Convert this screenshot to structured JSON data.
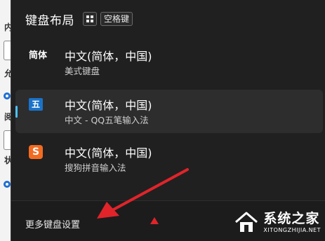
{
  "background_window": {
    "chars": [
      "内",
      "允",
      "阅",
      "状"
    ]
  },
  "flyout": {
    "title": "键盘布局",
    "layout_hotkey": "空格键",
    "items": [
      {
        "icon_text": "简体",
        "name": "中文(简体，中国)",
        "sub": "美式键盘",
        "selected": false
      },
      {
        "icon_text": "五",
        "name": "中文(简体，中国)",
        "sub": "中文 - QQ五笔输入法",
        "selected": true
      },
      {
        "icon_text": "S",
        "name": "中文(简体，中国)",
        "sub": "搜狗拼音输入法",
        "selected": false
      }
    ],
    "more_settings": "更多键盘设置"
  },
  "watermark": {
    "title": "系统之家",
    "url": "XITONGZHIJIA.NET"
  },
  "colors": {
    "flyout_bg": "#202020",
    "selected_bg": "#2d2d2d",
    "accent": "#4cc2ff",
    "annotation_red": "#e0242a"
  }
}
